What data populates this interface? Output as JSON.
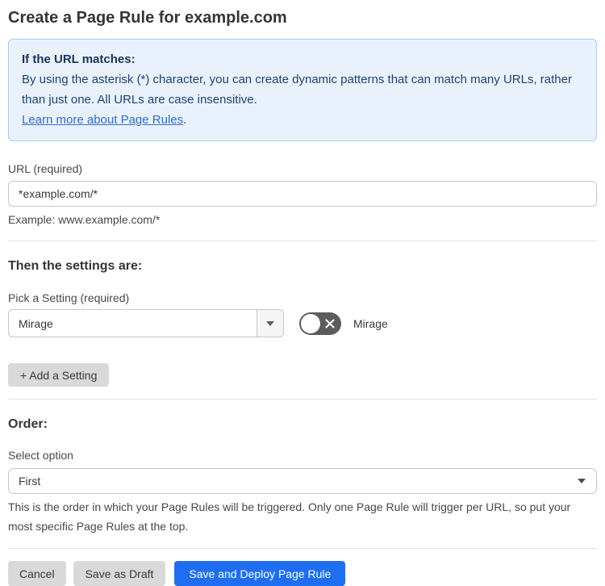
{
  "page": {
    "title": "Create a Page Rule for example.com"
  },
  "info_box": {
    "heading": "If the URL matches:",
    "body": "By using the asterisk (*) character, you can create dynamic patterns that can match many URLs, rather than just one. All URLs are case insensitive.",
    "link_text": "Learn more about Page Rules",
    "link_suffix": "."
  },
  "url_field": {
    "label": "URL (required)",
    "value": "*example.com/*",
    "example": "Example: www.example.com/*"
  },
  "settings": {
    "heading": "Then the settings are:",
    "picker_label": "Pick a Setting (required)",
    "selected_setting": "Mirage",
    "toggle_label": "Mirage",
    "toggle_state": "off",
    "add_button_label": "+ Add a Setting"
  },
  "order": {
    "heading": "Order:",
    "label": "Select option",
    "selected_option": "First",
    "help_text": "This is the order in which your Page Rules will be triggered. Only one Page Rule will trigger per URL, so put your most specific Page Rules at the top."
  },
  "actions": {
    "cancel_label": "Cancel",
    "save_draft_label": "Save as Draft",
    "save_deploy_label": "Save and Deploy Page Rule"
  },
  "colors": {
    "info_bg": "#e9f2fc",
    "info_border": "#a9cdf1",
    "info_text": "#1f4276",
    "link": "#2e6bd3",
    "primary_button": "#1f6ef2",
    "gray_button": "#d9d9d9",
    "text": "#36393a",
    "input_border": "#c6c6c6",
    "divider": "#e2e2e2",
    "toggle_bg": "#5c5c5c"
  }
}
